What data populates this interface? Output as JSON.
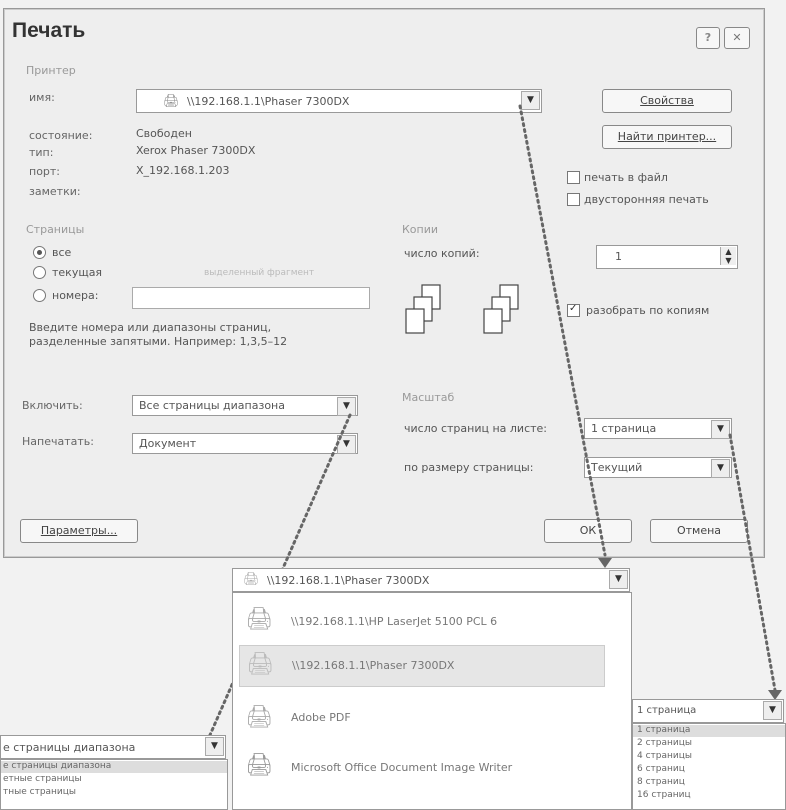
{
  "dialog": {
    "title": "Печать",
    "help_label": "?",
    "close_label": "✕",
    "printer": {
      "group_label": "Принтер",
      "name_label": "имя:",
      "name_value": "\\\\192.168.1.1\\Phaser 7300DX",
      "status_label": "состояние:",
      "status_value": "Свободен",
      "type_label": "тип:",
      "type_value": "Xerox Phaser 7300DX",
      "port_label": "порт:",
      "port_value": "X_192.168.1.203",
      "notes_label": "заметки:",
      "properties_button": "Свойства",
      "find_printer_button": "Найти принтер...",
      "print_to_file": "печать в файл",
      "duplex": "двусторонняя печать"
    },
    "pages": {
      "group_label": "Страницы",
      "all": "все",
      "current": "текущая",
      "selection": "выделенный фрагмент",
      "numbers": "номера:",
      "hint_line1": "Введите номера или диапазоны страниц,",
      "hint_line2": "разделенные запятыми. Например: 1,3,5–12"
    },
    "copies": {
      "group_label": "Копии",
      "count_label": "число копий:",
      "count_value": "1",
      "collate": "разобрать по копиям"
    },
    "include": {
      "label": "Включить:",
      "value": "Все страницы диапазона"
    },
    "print_what": {
      "label": "Напечатать:",
      "value": "Документ"
    },
    "scale": {
      "group_label": "Масштаб",
      "pages_per_sheet_label": "число страниц на листе:",
      "pages_per_sheet_value": "1 страница",
      "fit_label": "по размеру страницы:",
      "fit_value": "Текущий"
    },
    "options_button": "Параметры...",
    "ok_button": "ОК",
    "cancel_button": "Отмена"
  },
  "printer_dropdown": {
    "selected": "\\\\192.168.1.1\\Phaser 7300DX",
    "items": [
      "\\\\192.168.1.1\\HP LaserJet 5100 PCL 6",
      "\\\\192.168.1.1\\Phaser 7300DX",
      "Adobe PDF",
      "Microsoft Office Document Image Writer"
    ]
  },
  "pages_dropdown": {
    "selected": "1 страница",
    "items": [
      "1 страница",
      "2 страницы",
      "4 страницы",
      "6 страниц",
      "8 страниц",
      "16 страниц"
    ]
  },
  "include_dropdown": {
    "selected": "е страницы диапазона",
    "items": [
      "е страницы диапазона",
      "етные страницы",
      "тные страницы"
    ]
  }
}
